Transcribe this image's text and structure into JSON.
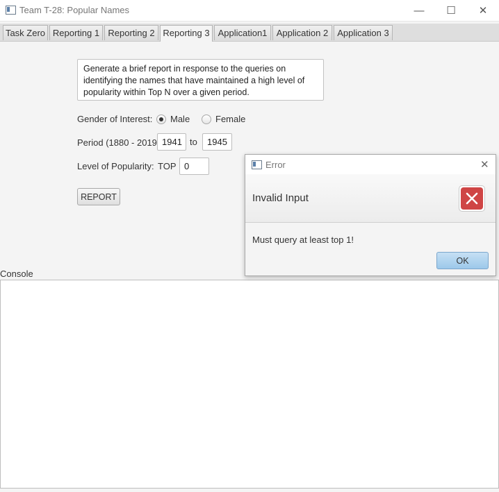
{
  "window": {
    "title": "Team T-28: Popular Names",
    "minimize_glyph": "—",
    "maximize_glyph": "☐",
    "close_glyph": "✕"
  },
  "tabs": [
    {
      "label": "Task Zero",
      "active": false
    },
    {
      "label": "Reporting 1",
      "active": false
    },
    {
      "label": "Reporting 2",
      "active": false
    },
    {
      "label": "Reporting 3",
      "active": true
    },
    {
      "label": "Application1",
      "active": false
    },
    {
      "label": "Application 2",
      "active": false
    },
    {
      "label": "Application 3",
      "active": false
    }
  ],
  "form": {
    "description": "Generate a brief report in response to the queries on identifying the names that have maintained a high level of popularity within Top N over a given period.",
    "gender_label": "Gender of Interest:",
    "male_label": "Male",
    "female_label": "Female",
    "selected_gender": "Male",
    "period_label": "Period (1880 - 2019)",
    "period_start": "1941",
    "period_to_label": "to",
    "period_end": "1945",
    "popularity_label": "Level of Popularity:",
    "top_label": "TOP",
    "top_value": "0",
    "report_button": "REPORT"
  },
  "console": {
    "label": "Console",
    "text": ""
  },
  "dialog": {
    "title": "Error",
    "header": "Invalid Input",
    "message": "Must query at least top 1!",
    "ok_button": "OK",
    "close_glyph": "✕"
  },
  "icons": {
    "app": "app-window-icon",
    "error": "error-x-icon"
  },
  "colors": {
    "error_red": "#cf4545",
    "ok_button_blue": "#a9cfec"
  }
}
